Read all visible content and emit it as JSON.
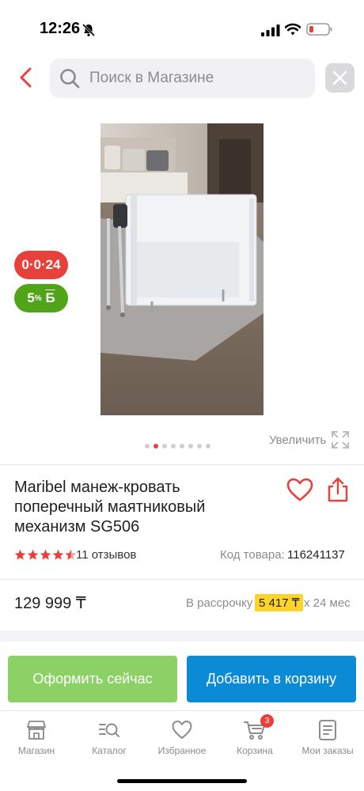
{
  "status_bar": {
    "time": "12:26"
  },
  "search": {
    "placeholder": "Поиск в Магазине"
  },
  "badges": {
    "installment": "0·0·24",
    "bonus_percent": "5",
    "bonus_symbol": "%",
    "bonus_letter": "Б"
  },
  "gallery": {
    "zoom_label": "Увеличить",
    "slide_count": 8,
    "active_slide": 2
  },
  "product": {
    "title": "Maribel манеж-кровать поперечный маятниковый механизм SG506",
    "rating": 4.5,
    "reviews": "11 отзывов",
    "sku_label": "Код товара:",
    "sku_value": "116241137",
    "price": "129 999 ₸",
    "installment_prefix": "В рассрочку",
    "installment_amount": "5 417 ₸",
    "installment_suffix": "х 24 мес"
  },
  "actions": {
    "buy_now": "Оформить сейчас",
    "add_to_cart": "Добавить в корзину"
  },
  "bottom_nav": {
    "items": [
      {
        "label": "Магазин",
        "icon": "store-icon"
      },
      {
        "label": "Каталог",
        "icon": "catalog-search-icon"
      },
      {
        "label": "Избранное",
        "icon": "heart-icon"
      },
      {
        "label": "Корзина",
        "icon": "cart-icon",
        "badge": "3"
      },
      {
        "label": "Мои заказы",
        "icon": "orders-icon"
      }
    ]
  },
  "colors": {
    "accent_red": "#e8403a",
    "bonus_green": "#4fa418",
    "buy_green": "#8bd165",
    "cart_blue": "#0b8ad5",
    "highlight_yellow": "#fed42b"
  }
}
